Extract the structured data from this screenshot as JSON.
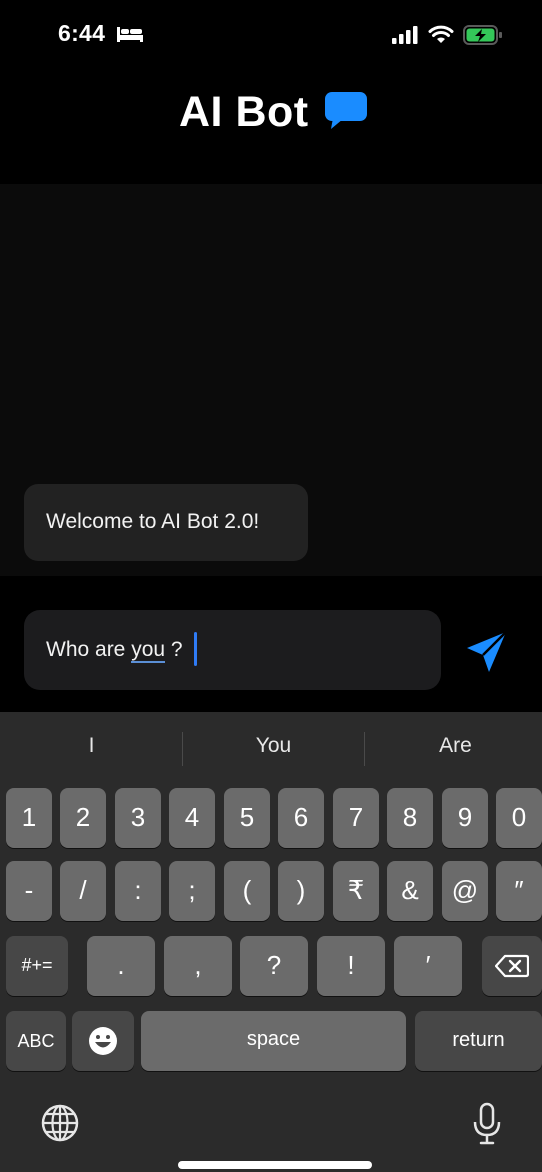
{
  "status_bar": {
    "time": "6:44"
  },
  "header": {
    "title": "AI Bot"
  },
  "chat": {
    "messages": [
      {
        "text": "Welcome to AI Bot 2.0!"
      }
    ]
  },
  "input": {
    "text_before": "Who are ",
    "text_underlined": "you",
    "text_after": " ?"
  },
  "keyboard": {
    "suggestions": [
      "I",
      "You",
      "Are"
    ],
    "row1": [
      "1",
      "2",
      "3",
      "4",
      "5",
      "6",
      "7",
      "8",
      "9",
      "0"
    ],
    "row2": [
      "-",
      "/",
      ":",
      ";",
      "(",
      ")",
      "₹",
      "&",
      "@",
      "″"
    ],
    "row3_left": "#+=",
    "row3": [
      ".",
      ",",
      "?",
      "!",
      "′"
    ],
    "abc": "ABC",
    "space": "space",
    "return": "return"
  },
  "colors": {
    "accent": "#1a8cff",
    "battery": "#34c759"
  }
}
